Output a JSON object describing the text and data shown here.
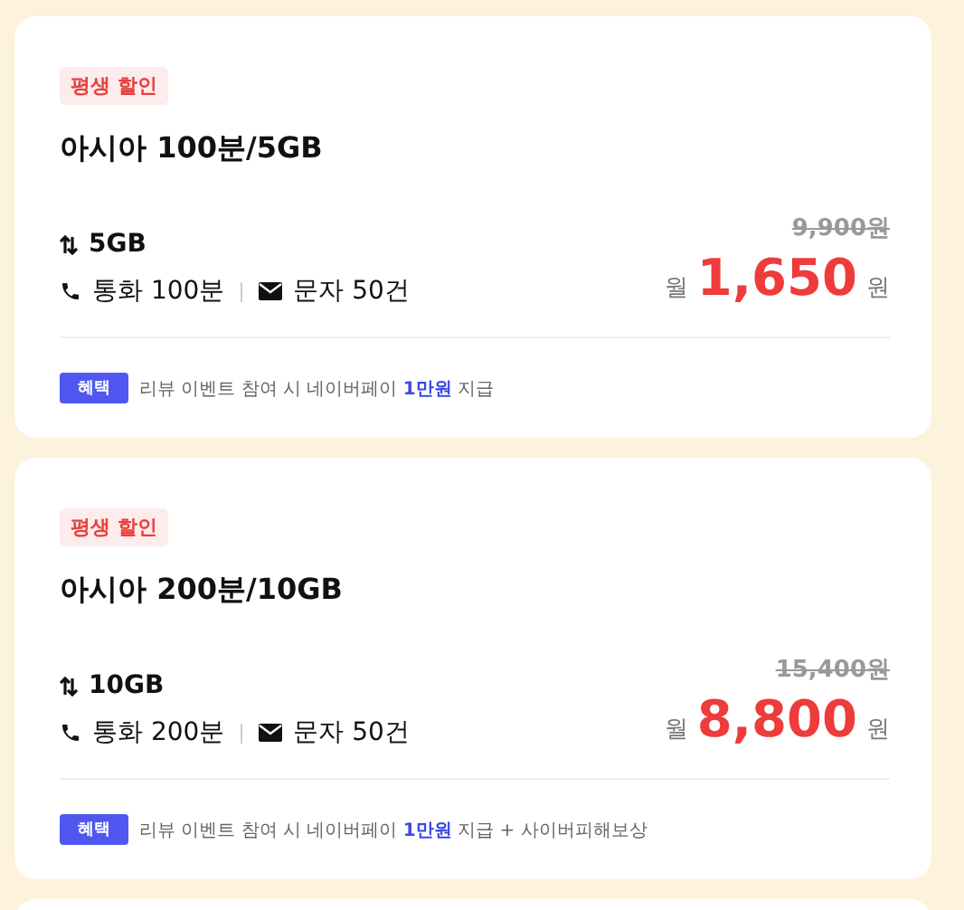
{
  "plans": [
    {
      "badge": "평생 할인",
      "title": "아시아 100분/5GB",
      "data": "5GB",
      "call": "통화 100분",
      "sms": "문자 50건",
      "original_price": "9,900원",
      "price_prefix": "월",
      "price": "1,650",
      "price_unit": "원",
      "benefit_tag": "혜택",
      "benefit_before": "리뷰 이벤트 참여 시 네이버페이",
      "benefit_highlight": "1만원",
      "benefit_after": "지급"
    },
    {
      "badge": "평생 할인",
      "title": "아시아 200분/10GB",
      "data": "10GB",
      "call": "통화 200분",
      "sms": "문자 50건",
      "original_price": "15,400원",
      "price_prefix": "월",
      "price": "8,800",
      "price_unit": "원",
      "benefit_tag": "혜택",
      "benefit_before": "리뷰 이벤트 참여 시 네이버페이",
      "benefit_highlight": "1만원",
      "benefit_after": "지급 + 사이버피해보상"
    }
  ]
}
